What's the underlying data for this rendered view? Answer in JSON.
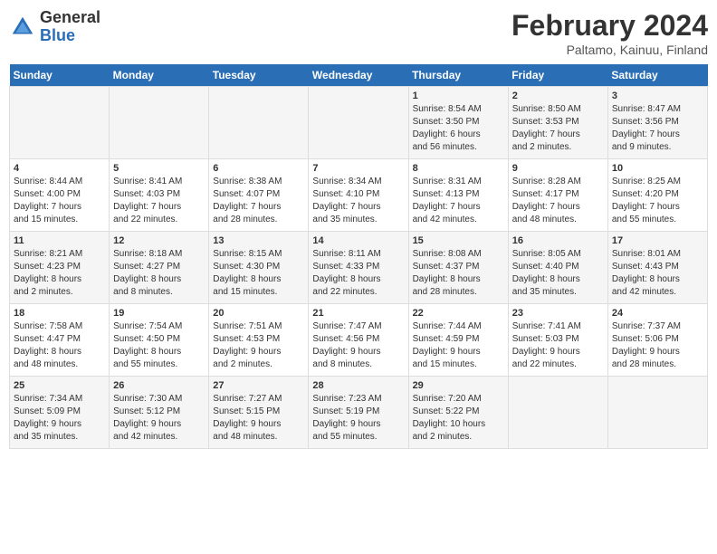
{
  "header": {
    "logo_general": "General",
    "logo_blue": "Blue",
    "main_title": "February 2024",
    "subtitle": "Paltamo, Kainuu, Finland"
  },
  "calendar": {
    "days_of_week": [
      "Sunday",
      "Monday",
      "Tuesday",
      "Wednesday",
      "Thursday",
      "Friday",
      "Saturday"
    ],
    "weeks": [
      [
        {
          "day": "",
          "info": ""
        },
        {
          "day": "",
          "info": ""
        },
        {
          "day": "",
          "info": ""
        },
        {
          "day": "",
          "info": ""
        },
        {
          "day": "1",
          "info": "Sunrise: 8:54 AM\nSunset: 3:50 PM\nDaylight: 6 hours\nand 56 minutes."
        },
        {
          "day": "2",
          "info": "Sunrise: 8:50 AM\nSunset: 3:53 PM\nDaylight: 7 hours\nand 2 minutes."
        },
        {
          "day": "3",
          "info": "Sunrise: 8:47 AM\nSunset: 3:56 PM\nDaylight: 7 hours\nand 9 minutes."
        }
      ],
      [
        {
          "day": "4",
          "info": "Sunrise: 8:44 AM\nSunset: 4:00 PM\nDaylight: 7 hours\nand 15 minutes."
        },
        {
          "day": "5",
          "info": "Sunrise: 8:41 AM\nSunset: 4:03 PM\nDaylight: 7 hours\nand 22 minutes."
        },
        {
          "day": "6",
          "info": "Sunrise: 8:38 AM\nSunset: 4:07 PM\nDaylight: 7 hours\nand 28 minutes."
        },
        {
          "day": "7",
          "info": "Sunrise: 8:34 AM\nSunset: 4:10 PM\nDaylight: 7 hours\nand 35 minutes."
        },
        {
          "day": "8",
          "info": "Sunrise: 8:31 AM\nSunset: 4:13 PM\nDaylight: 7 hours\nand 42 minutes."
        },
        {
          "day": "9",
          "info": "Sunrise: 8:28 AM\nSunset: 4:17 PM\nDaylight: 7 hours\nand 48 minutes."
        },
        {
          "day": "10",
          "info": "Sunrise: 8:25 AM\nSunset: 4:20 PM\nDaylight: 7 hours\nand 55 minutes."
        }
      ],
      [
        {
          "day": "11",
          "info": "Sunrise: 8:21 AM\nSunset: 4:23 PM\nDaylight: 8 hours\nand 2 minutes."
        },
        {
          "day": "12",
          "info": "Sunrise: 8:18 AM\nSunset: 4:27 PM\nDaylight: 8 hours\nand 8 minutes."
        },
        {
          "day": "13",
          "info": "Sunrise: 8:15 AM\nSunset: 4:30 PM\nDaylight: 8 hours\nand 15 minutes."
        },
        {
          "day": "14",
          "info": "Sunrise: 8:11 AM\nSunset: 4:33 PM\nDaylight: 8 hours\nand 22 minutes."
        },
        {
          "day": "15",
          "info": "Sunrise: 8:08 AM\nSunset: 4:37 PM\nDaylight: 8 hours\nand 28 minutes."
        },
        {
          "day": "16",
          "info": "Sunrise: 8:05 AM\nSunset: 4:40 PM\nDaylight: 8 hours\nand 35 minutes."
        },
        {
          "day": "17",
          "info": "Sunrise: 8:01 AM\nSunset: 4:43 PM\nDaylight: 8 hours\nand 42 minutes."
        }
      ],
      [
        {
          "day": "18",
          "info": "Sunrise: 7:58 AM\nSunset: 4:47 PM\nDaylight: 8 hours\nand 48 minutes."
        },
        {
          "day": "19",
          "info": "Sunrise: 7:54 AM\nSunset: 4:50 PM\nDaylight: 8 hours\nand 55 minutes."
        },
        {
          "day": "20",
          "info": "Sunrise: 7:51 AM\nSunset: 4:53 PM\nDaylight: 9 hours\nand 2 minutes."
        },
        {
          "day": "21",
          "info": "Sunrise: 7:47 AM\nSunset: 4:56 PM\nDaylight: 9 hours\nand 8 minutes."
        },
        {
          "day": "22",
          "info": "Sunrise: 7:44 AM\nSunset: 4:59 PM\nDaylight: 9 hours\nand 15 minutes."
        },
        {
          "day": "23",
          "info": "Sunrise: 7:41 AM\nSunset: 5:03 PM\nDaylight: 9 hours\nand 22 minutes."
        },
        {
          "day": "24",
          "info": "Sunrise: 7:37 AM\nSunset: 5:06 PM\nDaylight: 9 hours\nand 28 minutes."
        }
      ],
      [
        {
          "day": "25",
          "info": "Sunrise: 7:34 AM\nSunset: 5:09 PM\nDaylight: 9 hours\nand 35 minutes."
        },
        {
          "day": "26",
          "info": "Sunrise: 7:30 AM\nSunset: 5:12 PM\nDaylight: 9 hours\nand 42 minutes."
        },
        {
          "day": "27",
          "info": "Sunrise: 7:27 AM\nSunset: 5:15 PM\nDaylight: 9 hours\nand 48 minutes."
        },
        {
          "day": "28",
          "info": "Sunrise: 7:23 AM\nSunset: 5:19 PM\nDaylight: 9 hours\nand 55 minutes."
        },
        {
          "day": "29",
          "info": "Sunrise: 7:20 AM\nSunset: 5:22 PM\nDaylight: 10 hours\nand 2 minutes."
        },
        {
          "day": "",
          "info": ""
        },
        {
          "day": "",
          "info": ""
        }
      ]
    ]
  }
}
